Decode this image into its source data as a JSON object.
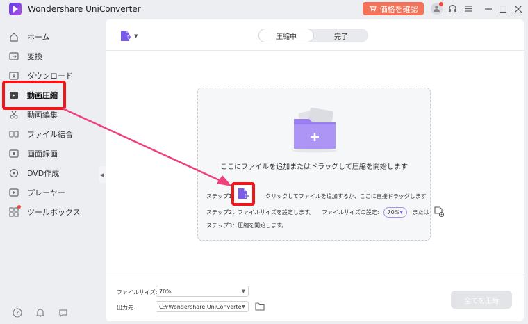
{
  "app": {
    "title": "Wondershare UniConverter",
    "buy_label": "価格を確認"
  },
  "sidebar": {
    "items": [
      {
        "label": "ホーム",
        "icon": "home-icon"
      },
      {
        "label": "変換",
        "icon": "convert-icon"
      },
      {
        "label": "ダウンロード",
        "icon": "download-icon"
      },
      {
        "label": "動画圧縮",
        "icon": "compress-icon",
        "active": true
      },
      {
        "label": "動画編集",
        "icon": "scissors-icon"
      },
      {
        "label": "ファイル結合",
        "icon": "merge-icon"
      },
      {
        "label": "画面録画",
        "icon": "record-icon"
      },
      {
        "label": "DVD作成",
        "icon": "dvd-icon"
      },
      {
        "label": "プレーヤー",
        "icon": "play-icon"
      },
      {
        "label": "ツールボックス",
        "icon": "grid-icon"
      }
    ]
  },
  "tabs": {
    "compressing": "圧縮中",
    "done": "完了"
  },
  "dropzone": {
    "main_text": "ここにファイルを追加またはドラッグして圧縮を開始します",
    "step1_label": "ステップ1：",
    "step1_text": "クリックしてファイルを追加するか、ここに直接ドラッグします",
    "step2_label": "ステップ2：ファイルサイズを設定します。",
    "step2_setting": "ファイルサイズの設定:",
    "step2_value": "70%",
    "step2_or": "または",
    "step3_text": "ステップ3：圧縮を開始します。"
  },
  "footer": {
    "file_size_label": "ファイルサイズ:",
    "file_size_value": "70%",
    "output_label": "出力先:",
    "output_value": "C:¥Wondershare UniConverter",
    "compress_all": "全てを圧縮"
  },
  "colors": {
    "accent": "#8a6cf0",
    "highlight": "#f0161a",
    "arrow": "#f0407a",
    "buy": "#f2735a"
  }
}
